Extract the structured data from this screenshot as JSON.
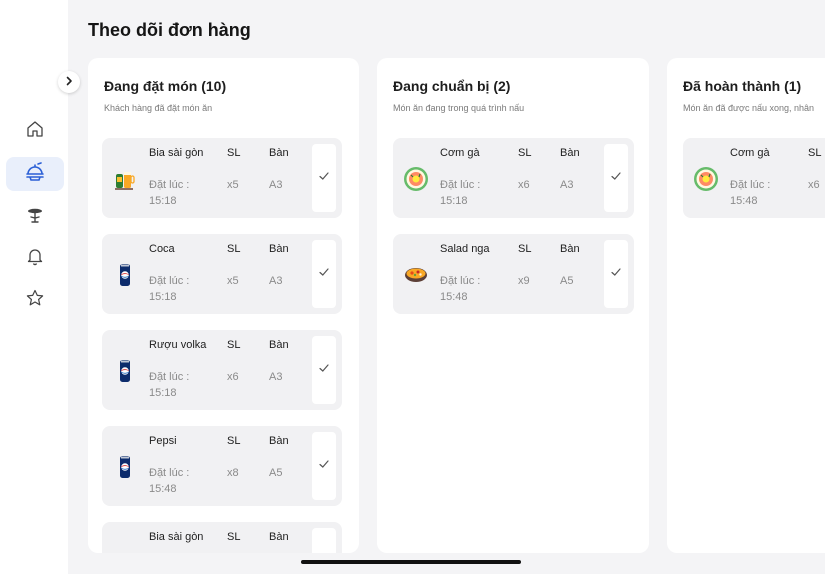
{
  "page": {
    "title": "Theo dõi đơn hàng"
  },
  "sidebar": {
    "items": [
      {
        "name": "home",
        "icon": "home-icon",
        "active": false
      },
      {
        "name": "orders",
        "icon": "food-tray-icon",
        "active": true
      },
      {
        "name": "tables",
        "icon": "table-icon",
        "active": false
      },
      {
        "name": "notifications",
        "icon": "bell-icon",
        "active": false
      },
      {
        "name": "favorites",
        "icon": "star-icon",
        "active": false
      }
    ]
  },
  "columns": [
    {
      "title": "Đang đặt món (10)",
      "subtitle": "Khách hàng đã đặt món ăn",
      "orders": [
        {
          "name": "Bia sài gòn",
          "sl_label": "SL",
          "ban_label": "Bàn",
          "time_label": "Đặt lúc :",
          "time": "15:18",
          "qty": "x5",
          "table": "A3",
          "thumb": "beer-icon"
        },
        {
          "name": "Coca",
          "sl_label": "SL",
          "ban_label": "Bàn",
          "time_label": "Đặt lúc :",
          "time": "15:18",
          "qty": "x5",
          "table": "A3",
          "thumb": "can-icon"
        },
        {
          "name": "Rượu volka",
          "sl_label": "SL",
          "ban_label": "Bàn",
          "time_label": "Đặt lúc :",
          "time": "15:18",
          "qty": "x6",
          "table": "A3",
          "thumb": "can-icon"
        },
        {
          "name": "Pepsi",
          "sl_label": "SL",
          "ban_label": "Bàn",
          "time_label": "Đặt lúc :",
          "time": "15:48",
          "qty": "x8",
          "table": "A5",
          "thumb": "can-icon"
        },
        {
          "name": "Bia sài gòn",
          "sl_label": "SL",
          "ban_label": "Bàn",
          "time_label": "",
          "time": "",
          "qty": "",
          "table": "",
          "thumb": "beer-icon"
        }
      ]
    },
    {
      "title": "Đang chuẩn bị (2)",
      "subtitle": "Món ăn đang trong quá trình nấu",
      "orders": [
        {
          "name": "Cơm gà",
          "sl_label": "SL",
          "ban_label": "Bàn",
          "time_label": "Đặt lúc :",
          "time": "15:18",
          "qty": "x6",
          "table": "A3",
          "thumb": "rice-plate-icon"
        },
        {
          "name": "Salad nga",
          "sl_label": "SL",
          "ban_label": "Bàn",
          "time_label": "Đặt lúc :",
          "time": "15:48",
          "qty": "x9",
          "table": "A5",
          "thumb": "salad-bowl-icon"
        }
      ]
    },
    {
      "title": "Đã hoàn thành (1)",
      "subtitle": "Món ăn đã được nấu xong, nhân",
      "orders": [
        {
          "name": "Cơm gà",
          "sl_label": "SL",
          "ban_label": "",
          "time_label": "Đặt lúc :",
          "time": "15:48",
          "qty": "x6",
          "table": "",
          "thumb": "rice-plate-icon"
        }
      ]
    }
  ],
  "colors": {
    "accent": "#2a5fd6",
    "active_bg": "#e9effb",
    "card_bg": "#f1f1f3",
    "page_bg": "#f4f4f6"
  }
}
